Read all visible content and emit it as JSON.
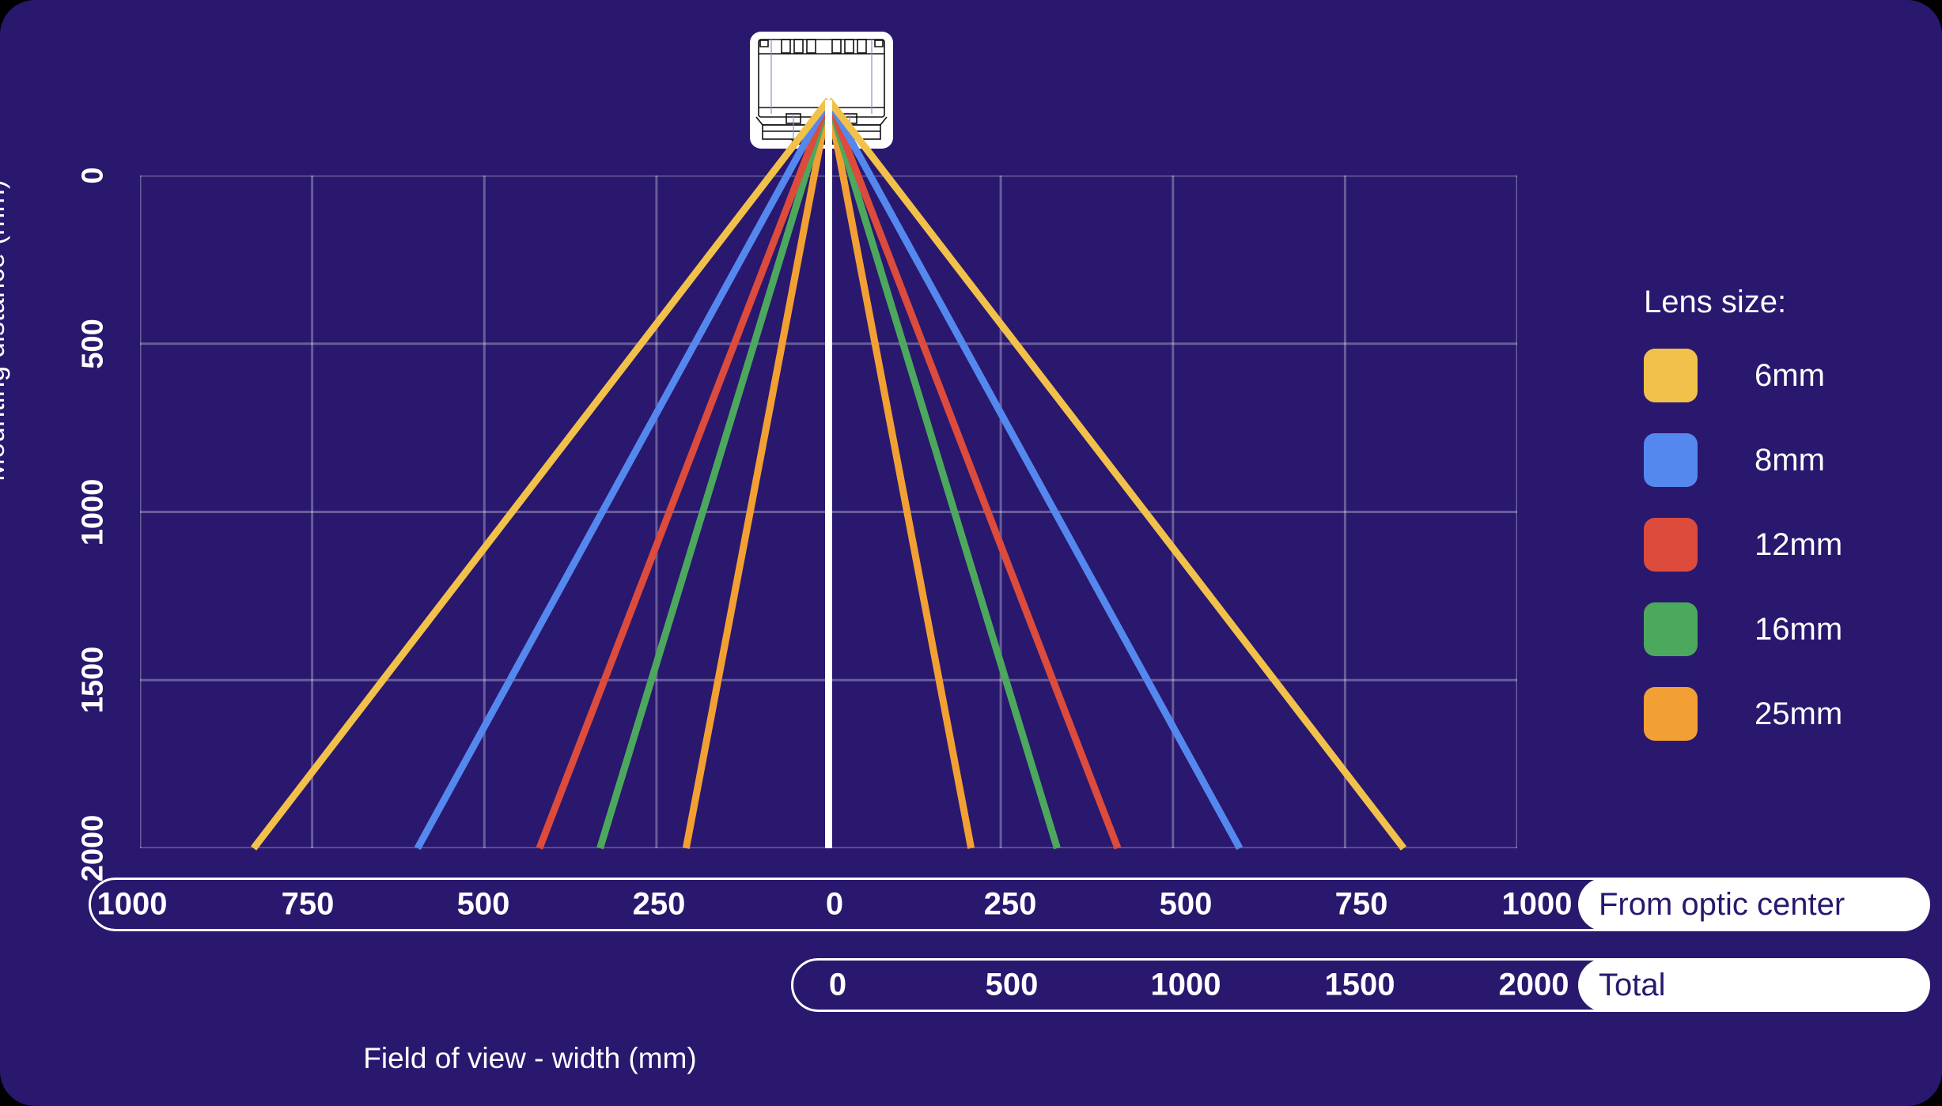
{
  "theme": {
    "background": "#29186E",
    "plot_background": "#29186E",
    "grid_color": "rgba(255,255,255,0.30)",
    "text_color": "#FFFFFF",
    "pill_background": "#FFFFFF",
    "pill_text_color": "#29186E",
    "center_line_color": "#FFFFFF"
  },
  "y_axis": {
    "title": "Mounting distance (mm)",
    "ticks": [
      "0",
      "500",
      "1000",
      "1500",
      "2000"
    ]
  },
  "x_axis": {
    "title": "Field of view - width (mm)",
    "bars": [
      {
        "pill_label": "From optic center",
        "ticks": [
          "1000",
          "750",
          "500",
          "250",
          "0",
          "250",
          "500",
          "750",
          "1000"
        ]
      },
      {
        "pill_label": "Total",
        "ticks": [
          "0",
          "500",
          "1000",
          "1500",
          "2000"
        ]
      }
    ]
  },
  "legend": {
    "title": "Lens size:",
    "items": [
      {
        "label": "6mm",
        "color": "#F2C14A"
      },
      {
        "label": "8mm",
        "color": "#5488EE"
      },
      {
        "label": "12mm",
        "color": "#DC4B3C"
      },
      {
        "label": "16mm",
        "color": "#4CA85C"
      },
      {
        "label": "25mm",
        "color": "#F2A033"
      }
    ]
  },
  "device": {
    "name": "camera-device",
    "description": "Camera illustration"
  },
  "chart_data": {
    "type": "line",
    "title": "",
    "xlabel": "Field of view - width (mm)",
    "ylabel": "Mounting distance (mm)",
    "xlim": [
      -1000,
      1000
    ],
    "ylim": [
      0,
      2000
    ],
    "y_inverted": true,
    "grid": true,
    "legend": "right",
    "x_ticks": [
      -1000,
      -750,
      -500,
      -250,
      0,
      250,
      500,
      750,
      1000
    ],
    "y_ticks": [
      0,
      500,
      1000,
      1500,
      2000
    ],
    "apex": {
      "x": 0,
      "y": -225
    },
    "center_line": {
      "x": 0,
      "y_from": 0,
      "y_to": 2000
    },
    "series": [
      {
        "name": "6mm",
        "color": "#F2C14A",
        "half_width_at_2000": 835,
        "left_end_x": -835,
        "right_end_x": 835
      },
      {
        "name": "8mm",
        "color": "#5488EE",
        "half_width_at_2000": 597,
        "left_end_x": -597,
        "right_end_x": 597
      },
      {
        "name": "12mm",
        "color": "#DC4B3C",
        "half_width_at_2000": 420,
        "left_end_x": -420,
        "right_end_x": 420
      },
      {
        "name": "16mm",
        "color": "#4CA85C",
        "half_width_at_2000": 332,
        "left_end_x": -332,
        "right_end_x": 332
      },
      {
        "name": "25mm",
        "color": "#F2A033",
        "half_width_at_2000": 207,
        "left_end_x": -207,
        "right_end_x": 207
      }
    ]
  }
}
